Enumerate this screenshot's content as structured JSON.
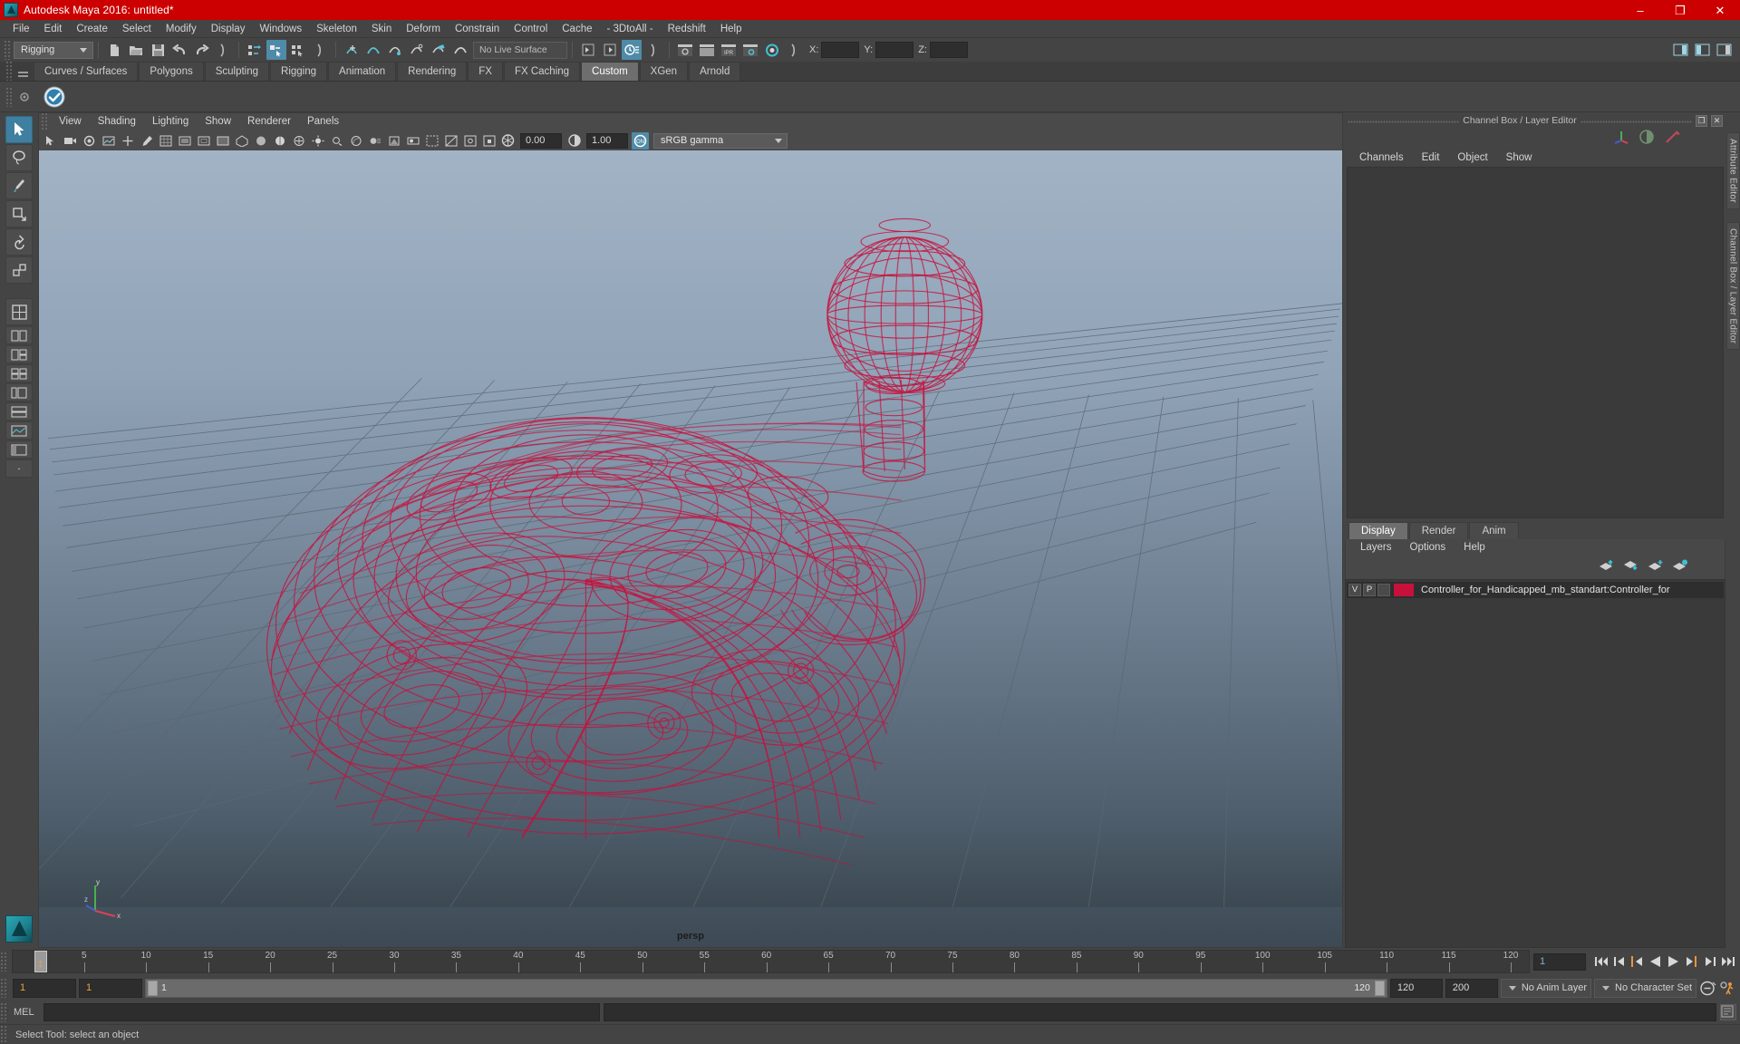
{
  "window": {
    "title": "Autodesk Maya 2016: untitled*",
    "logo_icon": "maya-logo-icon",
    "minimize": "–",
    "maximize": "❐",
    "close": "✕"
  },
  "menubar": {
    "items": [
      "File",
      "Edit",
      "Create",
      "Select",
      "Modify",
      "Display",
      "Windows",
      "Skeleton",
      "Skin",
      "Deform",
      "Constrain",
      "Control",
      "Cache",
      "- 3DtoAll -",
      "Redshift",
      "Help"
    ]
  },
  "statusbar": {
    "menuset": "Rigging",
    "live_surface": "No Live Surface",
    "axis_x_label": "X:",
    "axis_y_label": "Y:",
    "axis_z_label": "Z:",
    "axis_x_value": "",
    "axis_y_value": "",
    "axis_z_value": ""
  },
  "shelf": {
    "tabs": [
      "Curves / Surfaces",
      "Polygons",
      "Sculpting",
      "Rigging",
      "Animation",
      "Rendering",
      "FX",
      "FX Caching",
      "Custom",
      "XGen",
      "Arnold"
    ],
    "active_tab": "Custom"
  },
  "viewport": {
    "menus": [
      "View",
      "Shading",
      "Lighting",
      "Show",
      "Renderer",
      "Panels"
    ],
    "exposure_value": "0.00",
    "gamma_value": "1.00",
    "color_profile": "sRGB gamma",
    "camera_label": "persp",
    "wireframe_color": "#c8103c",
    "axis_x": "x",
    "axis_y": "y",
    "axis_z": "z"
  },
  "channelbox": {
    "title": "Channel Box / Layer Editor",
    "restore_glyph": "❐",
    "close_glyph": "✕",
    "menus": [
      "Channels",
      "Edit",
      "Object",
      "Show"
    ]
  },
  "layereditor": {
    "tabs": [
      "Display",
      "Render",
      "Anim"
    ],
    "active_tab": "Display",
    "menus": [
      "Layers",
      "Options",
      "Help"
    ],
    "layers": [
      {
        "visibility": "V",
        "playback": "P",
        "color": "#c8103c",
        "name": "Controller_for_Handicapped_mb_standart:Controller_for"
      }
    ]
  },
  "sidetabs": [
    "Attribute Editor",
    "Channel Box / Layer Editor"
  ],
  "timeline": {
    "ticks": [
      5,
      10,
      15,
      20,
      25,
      30,
      35,
      40,
      45,
      50,
      55,
      60,
      65,
      70,
      75,
      80,
      85,
      90,
      95,
      100,
      105,
      110,
      115,
      120
    ],
    "start": 1,
    "end": 120,
    "current_frame": "1",
    "playhead_label": "1",
    "current_frame_field": "1",
    "playback_buttons": [
      "go-to-start",
      "step-back-key",
      "step-back-frame",
      "play-backward",
      "play-forward",
      "step-forward-frame",
      "step-forward-key",
      "go-to-end"
    ]
  },
  "rangeslider": {
    "anim_start": "1",
    "playback_start": "1",
    "range_low": "1",
    "range_high": "120",
    "playback_end": "120",
    "anim_end": "200",
    "anim_layer": "No Anim Layer",
    "character_set": "No Character Set"
  },
  "commandline": {
    "language_label": "MEL",
    "input_value": "",
    "input_placeholder": ""
  },
  "helpline": {
    "text": "Select Tool: select an object"
  }
}
